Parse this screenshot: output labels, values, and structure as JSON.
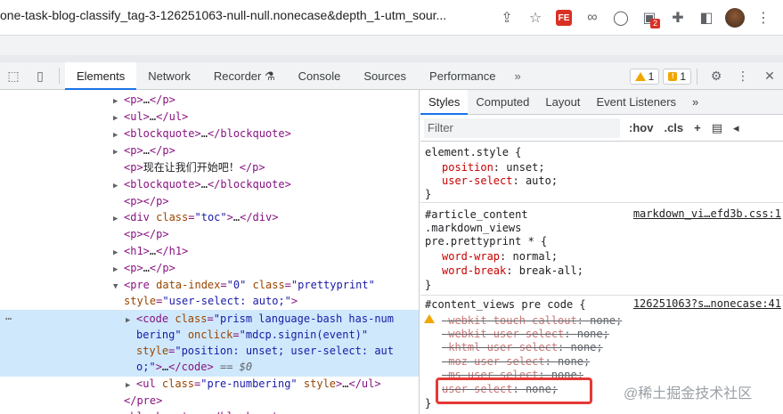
{
  "browser": {
    "url": "one-task-blog-classify_tag-3-126251063-null-null.nonecase&depth_1-utm_sour...",
    "fe_label": "FE",
    "ext_badge": "2"
  },
  "devtools": {
    "tabs": [
      "Elements",
      "Network",
      "Recorder",
      "Console",
      "Sources",
      "Performance"
    ],
    "more": "»",
    "warnings": "1",
    "issues": "1"
  },
  "elements": {
    "lines": [
      {
        "indent": 0,
        "arrow": "▶",
        "html": "p_collapsed"
      },
      {
        "indent": 0,
        "arrow": "▶",
        "html": "ul_collapsed"
      },
      {
        "indent": 0,
        "arrow": "▶",
        "html": "blockquote_collapsed"
      },
      {
        "indent": 0,
        "arrow": "▶",
        "html": "p_collapsed2"
      }
    ],
    "text_line": "现在让我们开始吧！",
    "toc_class": "toc",
    "pre_data_index": "0",
    "pre_class": "prettyprint",
    "pre_style": "user-select: auto;",
    "code_class": "prism language-bash has-numbering",
    "code_onclick": "mdcp.signin(event)",
    "code_style": "position: unset; user-select: auto;",
    "dollar": "== $0",
    "ul_class": "pre-numbering",
    "ul_style": "style"
  },
  "styles": {
    "tabs": [
      "Styles",
      "Computed",
      "Layout",
      "Event Listeners"
    ],
    "more": "»",
    "filter_placeholder": "Filter",
    "hov": ":hov",
    "cls": ".cls",
    "rule1": {
      "selector": "element.style {",
      "props": [
        {
          "name": "position",
          "value": "unset;"
        },
        {
          "name": "user-select",
          "value": "auto;"
        }
      ]
    },
    "rule2": {
      "selector_lines": [
        "#article_content",
        ".markdown_views",
        "pre.prettyprint * {"
      ],
      "source": "markdown_vi…efd3b.css:1",
      "props": [
        {
          "name": "word-wrap",
          "value": "normal;"
        },
        {
          "name": "word-break",
          "value": "break-all;"
        }
      ]
    },
    "rule3": {
      "selector": "#content_views pre code {",
      "source": "126251063?s…nonecase:41",
      "props": [
        {
          "name": "-webkit-touch-callout",
          "value": "none;"
        },
        {
          "name": "-webkit-user-select",
          "value": "none;"
        },
        {
          "name": "-khtml-user-select",
          "value": "none;"
        },
        {
          "name": "-moz-user-select",
          "value": "none;"
        },
        {
          "name": "-ms-user-select",
          "value": "none;"
        },
        {
          "name": "user-select",
          "value": "none;"
        }
      ]
    },
    "close_brace": "}"
  },
  "watermark": "@稀土掘金技术社区"
}
